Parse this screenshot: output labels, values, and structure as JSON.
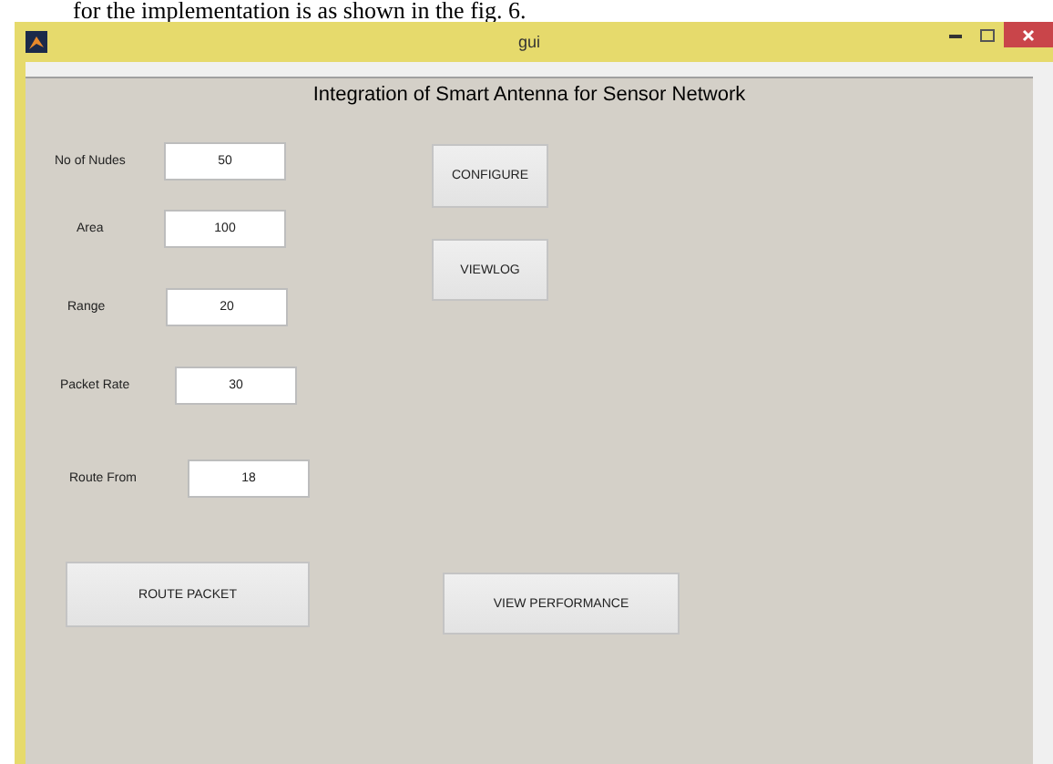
{
  "caption": "for the implementation is as shown in the fig. 6.",
  "window": {
    "title": "gui"
  },
  "panel": {
    "title": "Integration of Smart Antenna for Sensor Network"
  },
  "fields": [
    {
      "label": "No of Nudes",
      "value": "50"
    },
    {
      "label": "Area",
      "value": "100"
    },
    {
      "label": "Range",
      "value": "20"
    },
    {
      "label": "Packet Rate",
      "value": "30"
    },
    {
      "label": "Route From",
      "value": "18"
    }
  ],
  "side_buttons": [
    "CONFIGURE",
    "VIEWLOG"
  ],
  "bottom_buttons": [
    "ROUTE PACKET",
    "VIEW PERFORMANCE"
  ]
}
